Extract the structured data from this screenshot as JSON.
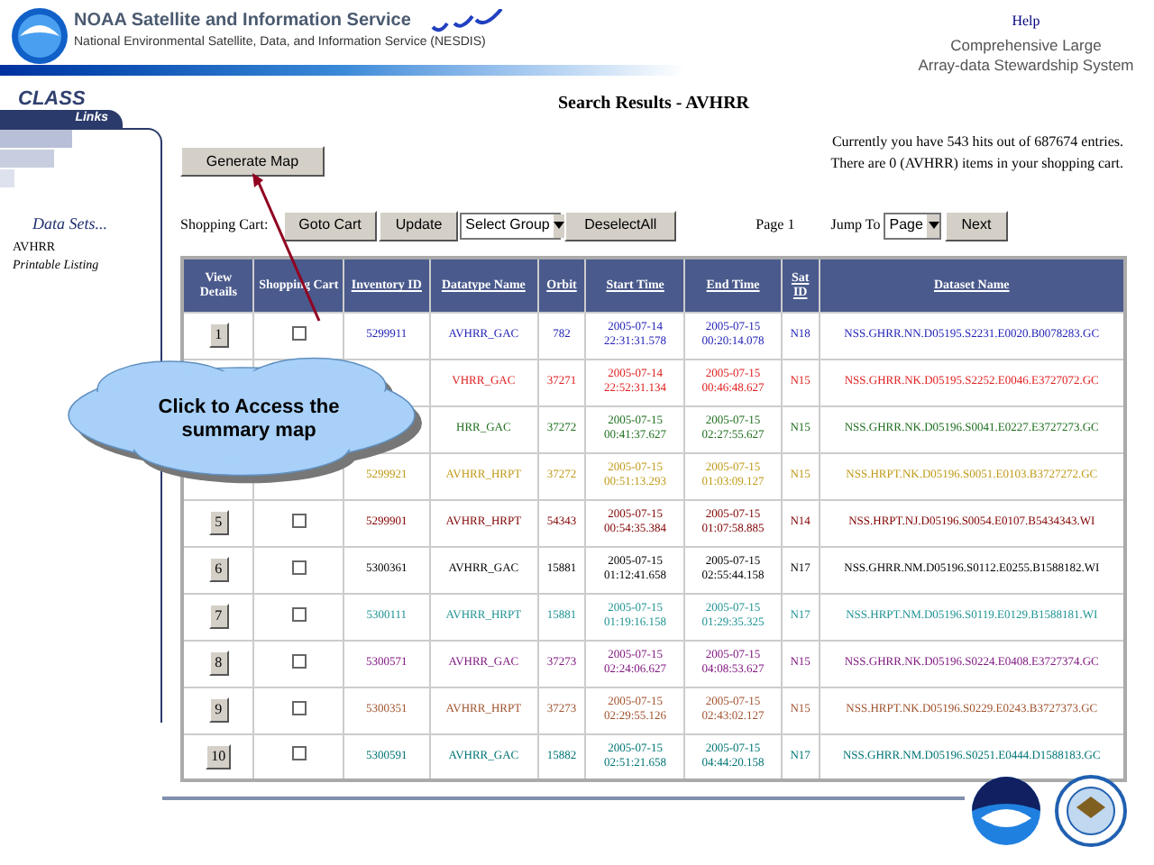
{
  "header": {
    "title": "NOAA Satellite and Information Service",
    "subtitle": "National Environmental Satellite, Data, and Information Service (NESDIS)",
    "help": "Help",
    "system_name": [
      "Comprehensive Large",
      "Array-data Stewardship System"
    ]
  },
  "sidebar": {
    "brand": "CLASS",
    "tab": "Links",
    "heading": "Data Sets...",
    "items": [
      {
        "label": "AVHRR",
        "italic": false
      },
      {
        "label": "Printable Listing",
        "italic": true
      }
    ]
  },
  "page_title": "Search Results - AVHRR",
  "generate_map": "Generate Map",
  "summary": [
    "Currently you have 543 hits out of 687674 entries.",
    "There are 0 (AVHRR) items in your shopping cart."
  ],
  "cart_bar": {
    "label": "Shopping Cart:",
    "buttons": [
      "Goto Cart",
      "Update"
    ],
    "group_select": "Select Group",
    "deselect": "DeselectAll",
    "page": "Page 1",
    "jump_label": "Jump To",
    "jump_select": "Page",
    "next": "Next"
  },
  "columns": [
    {
      "label": "View Details",
      "sortable": false
    },
    {
      "label": "Shopping Cart",
      "sortable": false
    },
    {
      "label": "Inventory ID",
      "sortable": true
    },
    {
      "label": "Datatype Name",
      "sortable": true
    },
    {
      "label": "Orbit",
      "sortable": true
    },
    {
      "label": "Start Time",
      "sortable": true
    },
    {
      "label": "End Time",
      "sortable": true
    },
    {
      "label": "Sat ID",
      "sortable": true
    },
    {
      "label": "Dataset Name",
      "sortable": true
    }
  ],
  "rows": [
    {
      "view": "1",
      "checked": false,
      "inventory_id": "5299911",
      "datatype": "AVHRR_GAC",
      "orbit": "782",
      "start": [
        "2005-07-14",
        "22:31:31.578"
      ],
      "end": [
        "2005-07-15",
        "00:20:14.078"
      ],
      "sat": "N18",
      "dataset": "NSS.GHRR.NN.D05195.S2231.E0020.B0078283.GC",
      "color": "#2323b8"
    },
    {
      "datatype": "VHRR_GAC",
      "orbit": "37271",
      "start": [
        "2005-07-14",
        "22:52:31.134"
      ],
      "end": [
        "2005-07-15",
        "00:46:48.627"
      ],
      "sat": "N15",
      "dataset": "NSS.GHRR.NK.D05195.S2252.E0046.E3727072.GC",
      "color": "#e02020"
    },
    {
      "datatype": "HRR_GAC",
      "orbit": "37272",
      "start": [
        "2005-07-15",
        "00:41:37.627"
      ],
      "end": [
        "2005-07-15",
        "02:27:55.627"
      ],
      "sat": "N15",
      "dataset": "NSS.GHRR.NK.D05196.S0041.E0227.E3727273.GC",
      "color": "#1e6e1e"
    },
    {
      "inventory_id": "5299921",
      "datatype": "AVHRR_HRPT",
      "orbit": "37272",
      "start": [
        "2005-07-15",
        "00:51:13.293"
      ],
      "end": [
        "2005-07-15",
        "01:03:09.127"
      ],
      "sat": "N15",
      "dataset": "NSS.HRPT.NK.D05196.S0051.E0103.B3727272.GC",
      "color": "#c09a18"
    },
    {
      "view": "5",
      "checked": false,
      "inventory_id": "5299901",
      "datatype": "AVHRR_HRPT",
      "orbit": "54343",
      "start": [
        "2005-07-15",
        "00:54:35.384"
      ],
      "end": [
        "2005-07-15",
        "01:07:58.885"
      ],
      "sat": "N14",
      "dataset": "NSS.HRPT.NJ.D05196.S0054.E0107.B5434343.WI",
      "color": "#800000"
    },
    {
      "view": "6",
      "checked": false,
      "inventory_id": "5300361",
      "datatype": "AVHRR_GAC",
      "orbit": "15881",
      "start": [
        "2005-07-15",
        "01:12:41.658"
      ],
      "end": [
        "2005-07-15",
        "02:55:44.158"
      ],
      "sat": "N17",
      "dataset": "NSS.GHRR.NM.D05196.S0112.E0255.B1588182.WI",
      "color": "#000000"
    },
    {
      "view": "7",
      "checked": false,
      "inventory_id": "5300111",
      "datatype": "AVHRR_HRPT",
      "orbit": "15881",
      "start": [
        "2005-07-15",
        "01:19:16.158"
      ],
      "end": [
        "2005-07-15",
        "01:29:35.325"
      ],
      "sat": "N17",
      "dataset": "NSS.HRPT.NM.D05196.S0119.E0129.B1588181.WI",
      "color": "#209494"
    },
    {
      "view": "8",
      "checked": false,
      "inventory_id": "5300571",
      "datatype": "AVHRR_GAC",
      "orbit": "37273",
      "start": [
        "2005-07-15",
        "02:24:06.627"
      ],
      "end": [
        "2005-07-15",
        "04:08:53.627"
      ],
      "sat": "N15",
      "dataset": "NSS.GHRR.NK.D05196.S0224.E0408.E3727374.GC",
      "color": "#801880"
    },
    {
      "view": "9",
      "checked": false,
      "inventory_id": "5300351",
      "datatype": "AVHRR_HRPT",
      "orbit": "37273",
      "start": [
        "2005-07-15",
        "02:29:55.126"
      ],
      "end": [
        "2005-07-15",
        "02:43:02.127"
      ],
      "sat": "N15",
      "dataset": "NSS.HRPT.NK.D05196.S0229.E0243.B3727373.GC",
      "color": "#a0522d"
    },
    {
      "view": "10",
      "checked": false,
      "inventory_id": "5300591",
      "datatype": "AVHRR_GAC",
      "orbit": "15882",
      "start": [
        "2005-07-15",
        "02:51:21.658"
      ],
      "end": [
        "2005-07-15",
        "04:44:20.158"
      ],
      "sat": "N17",
      "dataset": "NSS.GHRR.NM.D05196.S0251.E0444.D1588183.GC",
      "color": "#007474"
    }
  ],
  "callout": "Click to Access the summary map"
}
